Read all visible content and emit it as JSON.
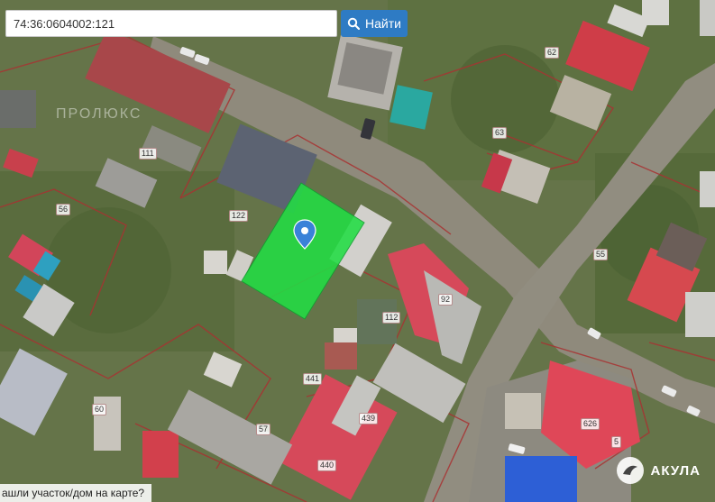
{
  "search": {
    "value": "74:36:0604002:121",
    "button_label": "Найти"
  },
  "plot_labels": [
    {
      "text": "62"
    },
    {
      "text": "63"
    },
    {
      "text": "111"
    },
    {
      "text": "56"
    },
    {
      "text": "122"
    },
    {
      "text": "55"
    },
    {
      "text": "92"
    },
    {
      "text": "112"
    },
    {
      "text": "441"
    },
    {
      "text": "439"
    },
    {
      "text": "60"
    },
    {
      "text": "57"
    },
    {
      "text": "440"
    },
    {
      "text": "626"
    },
    {
      "text": "5"
    }
  ],
  "watermark": "ПРОЛЮКС",
  "brand": "АКУЛА",
  "help_link": "ашли участок/дом на карте?",
  "colors": {
    "selected_plot": "#22dd44",
    "search_button": "#2e7bc4",
    "boundary": "#a83232",
    "red_roof": "#d9444e"
  }
}
